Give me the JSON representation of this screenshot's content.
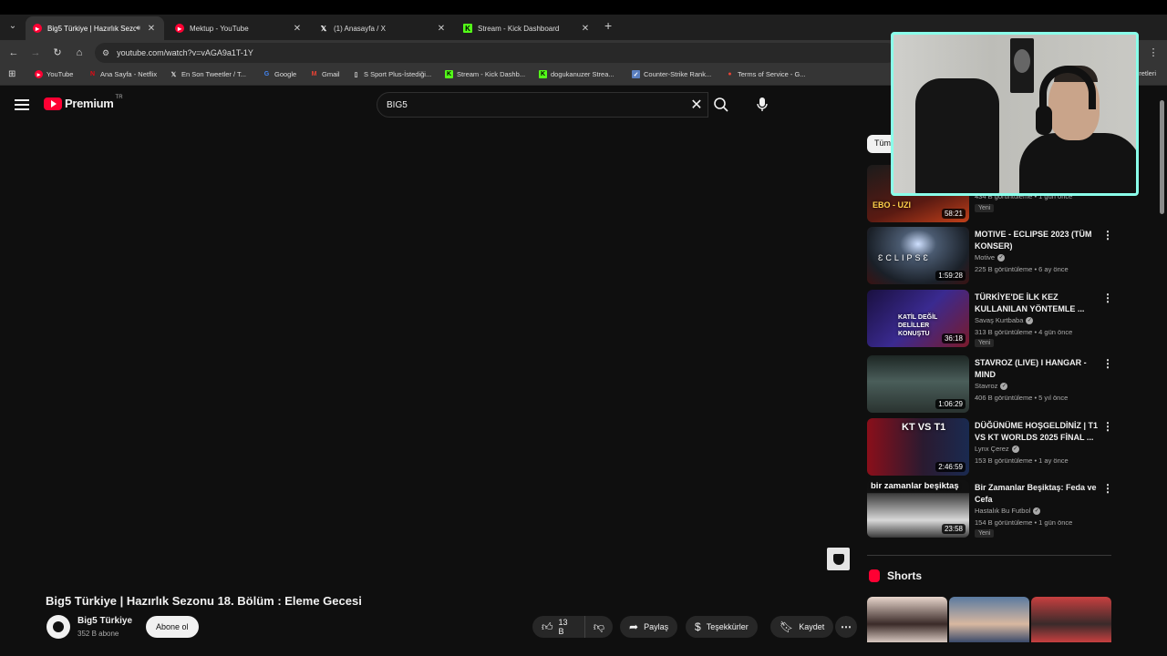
{
  "browser": {
    "tabs": [
      {
        "label": "Big5 Türkiye | Hazırlık Sezon",
        "icon": "youtube-icon",
        "active": true,
        "audio": true
      },
      {
        "label": "Mektup - YouTube",
        "icon": "youtube-icon",
        "active": false
      },
      {
        "label": "(1) Anasayfa / X",
        "icon": "x-icon",
        "active": false
      },
      {
        "label": "Stream - Kick Dashboard",
        "icon": "kick-icon",
        "active": false
      }
    ],
    "url": "youtube.com/watch?v=vAGA9a1T-1Y",
    "bookmarks": [
      {
        "label": "YouTube",
        "icon": "youtube-icon"
      },
      {
        "label": "Ana Sayfa - Netflix",
        "icon": "netflix-icon"
      },
      {
        "label": "En Son Tweetler / T...",
        "icon": "x-icon"
      },
      {
        "label": "Google",
        "icon": "google-icon"
      },
      {
        "label": "Gmail",
        "icon": "gmail-icon"
      },
      {
        "label": "S Sport Plus-İstediği...",
        "icon": "ssport-icon"
      },
      {
        "label": "Stream - Kick Dashb...",
        "icon": "kick-icon"
      },
      {
        "label": "dogukanuzer Strea...",
        "icon": "kick-icon"
      },
      {
        "label": "Counter-Strike Rank...",
        "icon": "cs-icon"
      },
      {
        "label": "Terms of Service - G...",
        "icon": "map-pin-icon"
      }
    ],
    "bookmarks_tail": "retleri"
  },
  "header": {
    "logo_text": "Premium",
    "logo_country": "TR",
    "search_value": "BİG5"
  },
  "chip_label": "Tüm",
  "video": {
    "title": "Big5 Türkiye | Hazırlık Sezonu 18. Bölüm : Eleme Gecesi",
    "channel": "Big5 Türkiye",
    "subscribers": "352 B abone",
    "subscribe_label": "Abone ol",
    "likes": "13 B",
    "share_label": "Paylaş",
    "thanks_label": "Teşekkürler",
    "save_label": "Kaydet"
  },
  "recommendations": [
    {
      "title": "",
      "channel": "",
      "meta": "434 B görüntüleme • 1 gün önce",
      "duration": "58:21",
      "badge": "Yeni",
      "thumb_text": "EBO - UZI",
      "thumb_color": "#5a1a12"
    },
    {
      "title": "MOTIVE - ECLIPSE 2023 (TÜM KONSER)",
      "channel": "Motive",
      "meta": "225 B görüntüleme • 6 ay önce",
      "duration": "1:59:28",
      "badge": "",
      "thumb_text": "ƐCLIPSƐ",
      "thumb_color": "#1e2a36"
    },
    {
      "title": "TÜRKİYE'DE İLK KEZ KULLANILAN YÖNTEMLE ...",
      "channel": "Savaş Kurtbaba",
      "meta": "313 B görüntüleme • 4 gün önce",
      "duration": "36:18",
      "badge": "Yeni",
      "thumb_text": "KATİL DEĞİL DELİLLER KONUŞTU",
      "thumb_color": "#2a1f6a"
    },
    {
      "title": "STAVROZ (LIVE) I HANGAR - MIND",
      "channel": "Stavroz",
      "meta": "406 B görüntüleme • 5 yıl önce",
      "duration": "1:06:29",
      "badge": "",
      "thumb_text": "",
      "thumb_color": "#3b4a48"
    },
    {
      "title": "DÜĞÜNÜME HOŞGELDİNİZ | T1 VS KT WORLDS 2025 FİNAL ...",
      "channel": "Lynx Çerez",
      "meta": "153 B görüntüleme • 1 ay önce",
      "duration": "2:46:59",
      "badge": "",
      "thumb_text": "KT VS T1",
      "thumb_color": "#7a1020"
    },
    {
      "title": "Bir Zamanlar Beşiktaş: Feda ve Cefa",
      "channel": "Hastalık Bu Futbol",
      "meta": "154 B görüntüleme • 1 gün önce",
      "duration": "23:58",
      "badge": "Yeni",
      "thumb_text": "bir zamanlar beşiktaş",
      "thumb_color": "#2d2d2d"
    }
  ],
  "shorts": {
    "label": "Shorts",
    "thumb_colors": [
      "#d8c8c0",
      "#5a7aa0",
      "#c84040"
    ]
  }
}
